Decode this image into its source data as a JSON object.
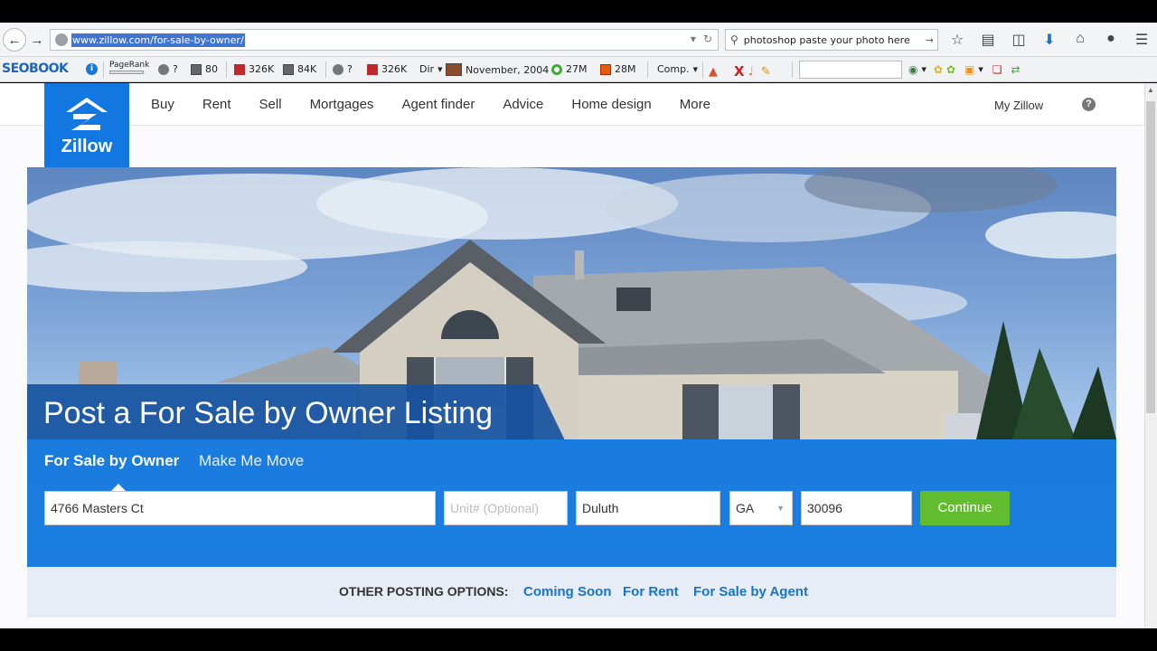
{
  "browser": {
    "url": "www.zillow.com/for-sale-by-owner/",
    "search_query": "photoshop paste your photo here"
  },
  "seo_toolbar": {
    "logo": "SEOBOOK",
    "pagerank_label": "PageRank",
    "pagerank_value": "?",
    "alexa_count": "80",
    "bl1": "326K",
    "bl2": "84K",
    "cache": "?",
    "bl3": "326K",
    "dir": "Dir",
    "date": "November, 2004",
    "val1": "27M",
    "val2": "28M",
    "comp": "Comp."
  },
  "site": {
    "logo_text": "Zillow",
    "nav": [
      "Buy",
      "Rent",
      "Sell",
      "Mortgages",
      "Agent finder",
      "Advice",
      "Home design",
      "More"
    ],
    "my_zillow": "My Zillow",
    "help": "?"
  },
  "hero": {
    "title": "Post a For Sale by Owner Listing",
    "tabs": [
      "For Sale by Owner",
      "Make Me Move"
    ]
  },
  "form": {
    "street": "4766 Masters Ct",
    "unit_placeholder": "Unit# (Optional)",
    "city": "Duluth",
    "state": "GA",
    "zip": "30096",
    "continue": "Continue"
  },
  "other_options": {
    "label": "OTHER POSTING OPTIONS:",
    "links": [
      "Coming Soon",
      "For Rent",
      "For Sale by Agent"
    ]
  }
}
